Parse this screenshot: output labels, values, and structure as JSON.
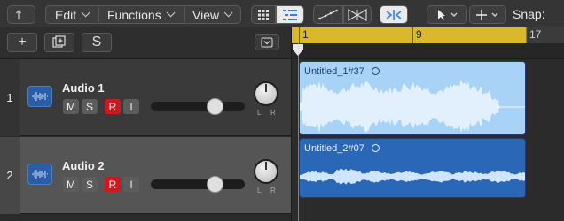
{
  "toolbar": {
    "menus": [
      {
        "label": "Edit"
      },
      {
        "label": "Functions"
      },
      {
        "label": "View"
      }
    ],
    "snap_label": "Snap:"
  },
  "header_toolbar": {
    "add_label": "+",
    "solo_label": "S"
  },
  "ruler": {
    "bars": [
      "1",
      "9",
      "17"
    ]
  },
  "tracks": [
    {
      "number": "1",
      "name": "Audio 1",
      "buttons": {
        "mute": "M",
        "solo": "S",
        "record": "R",
        "input": "I"
      },
      "volume_level": 0.72,
      "pan_labels": {
        "left": "L",
        "right": "R"
      }
    },
    {
      "number": "2",
      "name": "Audio 2",
      "buttons": {
        "mute": "M",
        "solo": "S",
        "record": "R",
        "input": "I"
      },
      "volume_level": 0.72,
      "pan_labels": {
        "left": "L",
        "right": "R"
      }
    }
  ],
  "regions": [
    {
      "name": "Untitled_1#37"
    },
    {
      "name": "Untitled_2#07"
    }
  ],
  "colors": {
    "ruler": "#d9b92a",
    "region_selected": "#a9d2f7",
    "region": "#2b67b7",
    "record": "#d0161e",
    "accent": "#2e7ff0"
  }
}
